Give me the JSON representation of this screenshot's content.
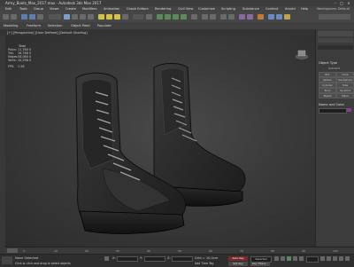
{
  "window": {
    "title": "Army_Boots_Max_2017.max - Autodesk 3ds Max 2017",
    "minimize_icon": "minimize-icon",
    "maximize_icon": "maximize-icon",
    "close_icon": "close-icon"
  },
  "menu": [
    "Edit",
    "Tools",
    "Group",
    "Views",
    "Create",
    "Modifiers",
    "Animation",
    "Graph Editors",
    "Rendering",
    "Civil View",
    "Customize",
    "Scripting",
    "Substance",
    "Content",
    "Arnold",
    "Help"
  ],
  "menu_search": "Workspaces: Default",
  "toolbar2": {
    "label_a": "Modeling",
    "label_b": "Freeform",
    "label_c": "Selection",
    "label_d": "Object Paint",
    "label_e": "Populate"
  },
  "viewport": {
    "label": "[+] [Perspective] [User Defined] [Default Shading]",
    "stats_header": "Total",
    "stats": [
      {
        "k": "Polys:",
        "v": "11,780",
        "z": "0"
      },
      {
        "k": "Tris:",
        "v": "16,788",
        "z": "0"
      },
      {
        "k": "Edges:",
        "v": "34,080",
        "z": "0"
      },
      {
        "k": "Verts:",
        "v": "10,298",
        "z": "0"
      }
    ],
    "fps_label": "FPS:",
    "fps_value": "1.28"
  },
  "rightpanel": {
    "object_type_header": "Object Type",
    "autogrid": "AutoGrid",
    "buttons": [
      "Box",
      "Cone",
      "Sphere",
      "GeoSphere",
      "Cylinder",
      "Tube",
      "Torus",
      "Pyramid",
      "Teapot",
      "Plane"
    ],
    "name_color_header": "Name and Color"
  },
  "timeline": {
    "ticks": [
      "0",
      "10",
      "20",
      "30",
      "40",
      "50",
      "60",
      "70",
      "80",
      "90",
      "100"
    ]
  },
  "status": {
    "left_label": "None Selected",
    "hint": "Click or click-and-drag to select objects",
    "x_label": "X:",
    "y_label": "Y:",
    "z_label": "Z:",
    "grid_label": "Grid = 10,0cm",
    "addtime": "Add Time Tag",
    "autokey": "Auto Key",
    "selected": "Selected",
    "setkey": "Set Key",
    "keyfilters": "Key Filters..."
  }
}
